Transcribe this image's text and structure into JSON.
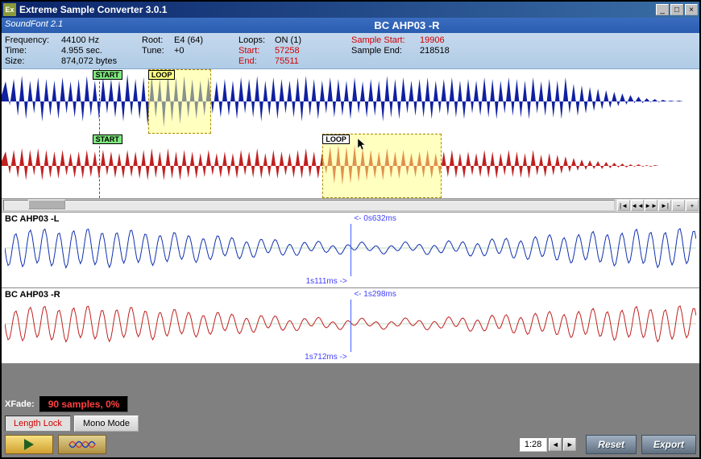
{
  "title": "Extreme Sample Converter 3.0.1",
  "header": {
    "format": "SoundFont 2.1",
    "sample_name": "BC AHP03  -R"
  },
  "info": {
    "frequency_label": "Frequency:",
    "frequency": "44100 Hz",
    "time_label": "Time:",
    "time": "4.955 sec.",
    "size_label": "Size:",
    "size": "874,072 bytes",
    "root_label": "Root:",
    "root": "E4 (64)",
    "tune_label": "Tune:",
    "tune": "+0",
    "loops_label": "Loops:",
    "loops": "ON (1)",
    "start_label": "Start:",
    "start": "57258",
    "end_label": "End:",
    "end": "75511",
    "sample_start_label": "Sample Start:",
    "sample_start": "19906",
    "sample_end_label": "Sample End:",
    "sample_end": "218518"
  },
  "markers": {
    "start": "START",
    "loop": "LOOP"
  },
  "zoom": {
    "left_label": "BC AHP03  -L",
    "right_label": "BC AHP03  -R",
    "t_top_in": "<- 0s632ms",
    "t_top_out": "1s111ms ->",
    "t_bot_in": "<- 1s298ms",
    "t_bot_out": "1s712ms ->"
  },
  "xfade": {
    "label": "XFade:",
    "value": "90 samples, 0%"
  },
  "toggles": {
    "length_lock": "Length Lock",
    "mono_mode": "Mono Mode"
  },
  "page": "1:28",
  "buttons": {
    "reset": "Reset",
    "export": "Export"
  },
  "icons": {
    "app": "Ex",
    "min": "_",
    "max": "□",
    "close": "×",
    "left": "◄",
    "right": "►",
    "play": "▶",
    "rewind": "|◄",
    "back": "◄◄",
    "fwd": "►►",
    "end": "►|",
    "zoom_in": "+",
    "zoom_out": "−"
  }
}
